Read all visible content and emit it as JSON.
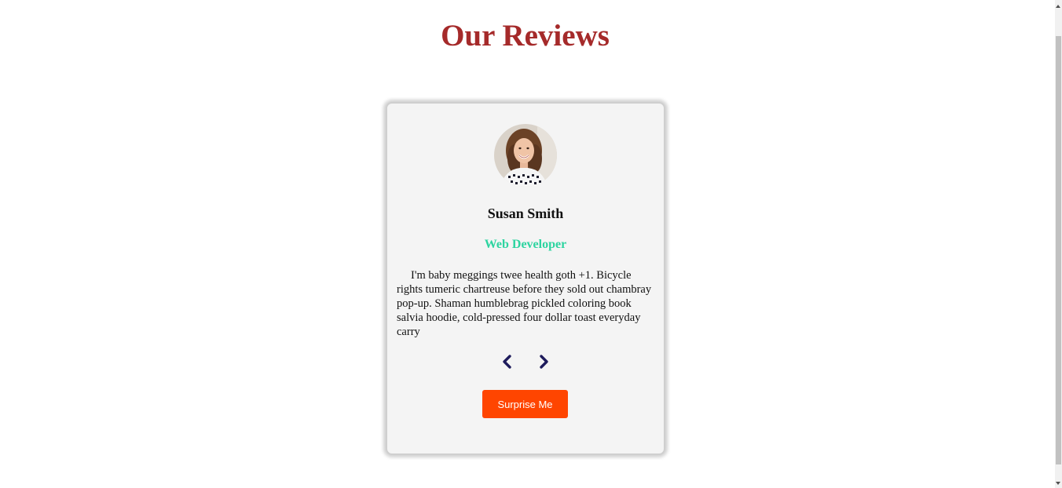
{
  "header": {
    "title": "Our Reviews"
  },
  "review": {
    "name": "Susan Smith",
    "job": "Web Developer",
    "text": "I'm baby meggings twee health goth +1. Bicycle rights tumeric chartreuse before they sold out chambray pop-up. Shaman humblebrag pickled coloring book salvia hoodie, cold-pressed four dollar toast everyday carry",
    "avatar_icon": "person-photo"
  },
  "controls": {
    "prev_icon": "chevron-left-icon",
    "next_icon": "chevron-right-icon",
    "surprise_label": "Surprise Me"
  },
  "colors": {
    "title": "#a52a2a",
    "job": "#2dd4a0",
    "chevron": "#1e1b5c",
    "surprise_button": "#ff4500",
    "card_bg": "#f4f4f4"
  }
}
